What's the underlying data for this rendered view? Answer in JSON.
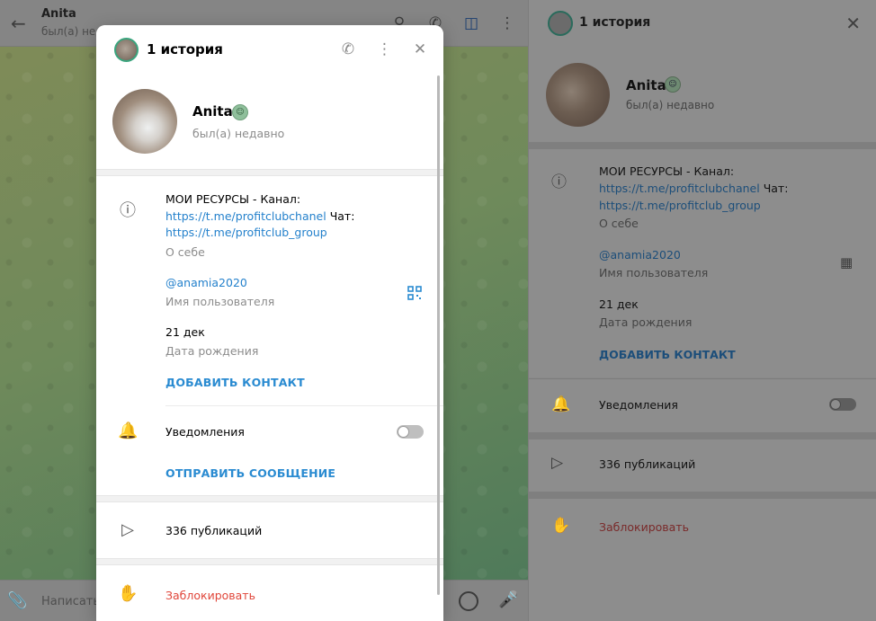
{
  "chat": {
    "name": "Anita",
    "status": "был(а) недавно",
    "input_placeholder": "Написать",
    "header_icons": [
      "search-icon",
      "phone-icon",
      "sidebar-toggle-icon",
      "more-icon"
    ]
  },
  "modal": {
    "title": "1 история",
    "header_icons": [
      "phone-icon",
      "more-icon",
      "close-icon"
    ],
    "name": "Anita",
    "status": "был(а) недавно",
    "bio_prefix": "МОИ РЕСУРСЫ - Канал:",
    "bio_link1": "https://t.me/profitclubchanel",
    "bio_chat": " Чат:",
    "bio_link2": "https://t.me/profitclub_group",
    "bio_label": "О себе",
    "username": "@anamia2020",
    "username_label": "Имя пользователя",
    "birthday": "21 дек",
    "birthday_label": "Дата рождения",
    "add_contact": "ДОБАВИТЬ КОНТАКТ",
    "notifications": "Уведомления",
    "notifications_on": false,
    "send_message": "ОТПРАВИТЬ СООБЩЕНИЕ",
    "publications": "336 публикаций",
    "block": "Заблокировать"
  },
  "side": {
    "title": "1 история",
    "name": "Anita",
    "status": "был(а) недавно",
    "bio_prefix": "МОИ РЕСУРСЫ - Канал:",
    "bio_link1": "https://t.me/profitclubchanel",
    "bio_chat": " Чат:",
    "bio_link2": "https://t.me/profitclub_group",
    "bio_label": "О себе",
    "username": "@anamia2020",
    "username_label": "Имя пользователя",
    "birthday": "21 дек",
    "birthday_label": "Дата рождения",
    "add_contact": "ДОБАВИТЬ КОНТАКТ",
    "notifications": "Уведомления",
    "notifications_on": false,
    "publications": "336 публикаций",
    "block": "Заблокировать"
  },
  "colors": {
    "accent": "#2481cc",
    "danger": "#e0463a",
    "story_ring": "#3aa57e"
  }
}
